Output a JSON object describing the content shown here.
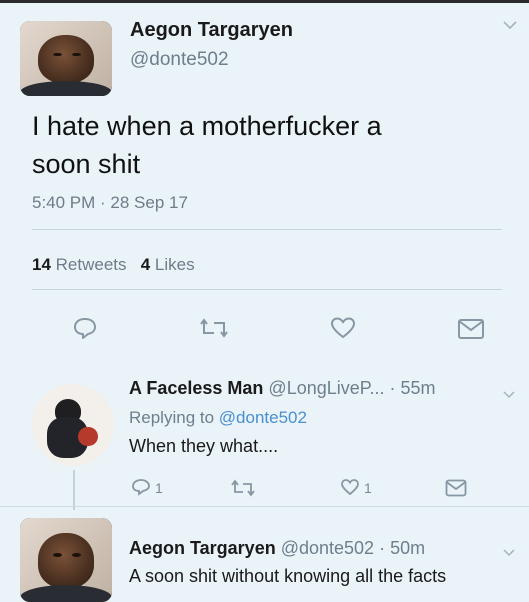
{
  "main_tweet": {
    "author_name": "Aegon Targaryen",
    "handle": "@donte502",
    "text_line1": "I hate when a motherfucker a",
    "text_line2": "soon shit",
    "timestamp": "5:40 PM · 28 Sep 17",
    "retweets_count": "14",
    "retweets_label": "Retweets",
    "likes_count": "4",
    "likes_label": "Likes"
  },
  "replies": [
    {
      "author_name": "A Faceless Man",
      "handle": "@LongLiveP...",
      "time": "· 55m",
      "replying_prefix": "Replying to",
      "replying_to": "@donte502",
      "text": "When they what....",
      "reply_count": "1",
      "like_count": "1"
    },
    {
      "author_name": "Aegon Targaryen",
      "handle": "@donte502",
      "time": "· 50m",
      "text": "A soon shit without knowing all the facts"
    }
  ],
  "colors": {
    "background": "#eaf3f8",
    "link": "#4a8fce",
    "meta": "#6e7f8c"
  },
  "icons": [
    "reply-icon",
    "retweet-icon",
    "like-icon",
    "message-icon",
    "chevron-down-icon"
  ]
}
